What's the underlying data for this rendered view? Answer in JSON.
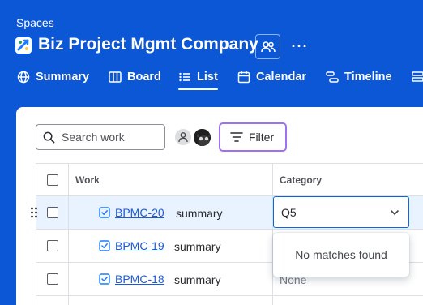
{
  "header": {
    "spaces_label": "Spaces",
    "project_title": "Biz Project Mgmt Company",
    "more_label": "···"
  },
  "tabs": [
    {
      "label": "Summary",
      "icon": "globe-icon"
    },
    {
      "label": "Board",
      "icon": "board-icon"
    },
    {
      "label": "List",
      "icon": "list-icon",
      "active": true
    },
    {
      "label": "Calendar",
      "icon": "calendar-icon"
    },
    {
      "label": "Timeline",
      "icon": "timeline-icon"
    }
  ],
  "toolbar": {
    "search_placeholder": "Search work",
    "filter_label": "Filter"
  },
  "table": {
    "columns": [
      "Work",
      "Category"
    ],
    "rows": [
      {
        "key": "BPMC-20",
        "summary": "summary",
        "category": "Q5",
        "selected": true
      },
      {
        "key": "BPMC-19",
        "summary": "summary",
        "category": ""
      },
      {
        "key": "BPMC-18",
        "summary": "summary",
        "category": "None"
      }
    ]
  },
  "dropdown": {
    "value": "Q5",
    "empty_message": "No matches found"
  },
  "colors": {
    "background": "#0b57d6",
    "accent": "#0c66e4",
    "filter_border": "#9f70f0",
    "selected_row": "#e9f2ff"
  }
}
